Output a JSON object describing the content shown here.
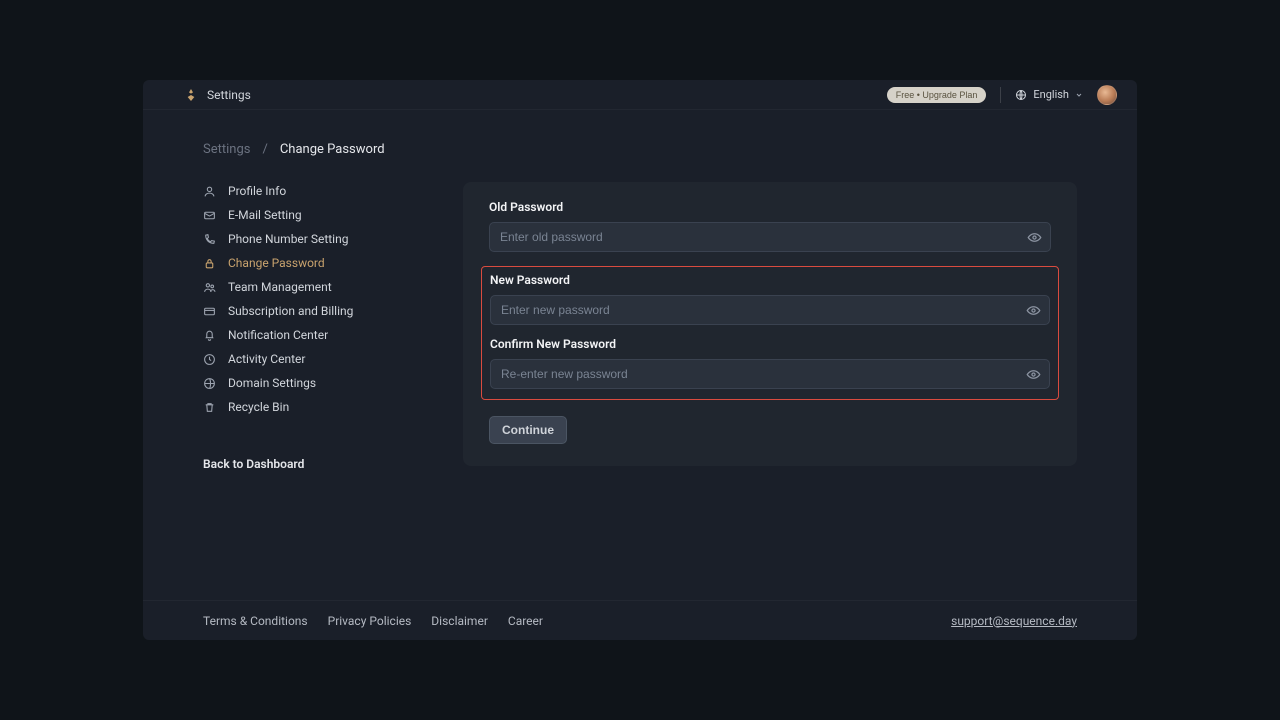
{
  "header": {
    "title": "Settings",
    "upgrade_label": "Free • Upgrade Plan",
    "language_label": "English"
  },
  "breadcrumb": {
    "root": "Settings",
    "separator": "/",
    "current": "Change Password"
  },
  "sidebar": {
    "items": [
      {
        "label": "Profile Info"
      },
      {
        "label": "E-Mail Setting"
      },
      {
        "label": "Phone Number Setting"
      },
      {
        "label": "Change Password"
      },
      {
        "label": "Team Management"
      },
      {
        "label": "Subscription and Billing"
      },
      {
        "label": "Notification Center"
      },
      {
        "label": "Activity Center"
      },
      {
        "label": "Domain Settings"
      },
      {
        "label": "Recycle Bin"
      }
    ],
    "back_label": "Back to Dashboard"
  },
  "form": {
    "old_password": {
      "label": "Old Password",
      "placeholder": "Enter old password"
    },
    "new_password": {
      "label": "New Password",
      "placeholder": "Enter new password"
    },
    "confirm_password": {
      "label": "Confirm New Password",
      "placeholder": "Re-enter new password"
    },
    "continue_label": "Continue"
  },
  "footer": {
    "links": [
      "Terms & Conditions",
      "Privacy Policies",
      "Disclaimer",
      "Career"
    ],
    "support_email": "support@sequence.day"
  }
}
